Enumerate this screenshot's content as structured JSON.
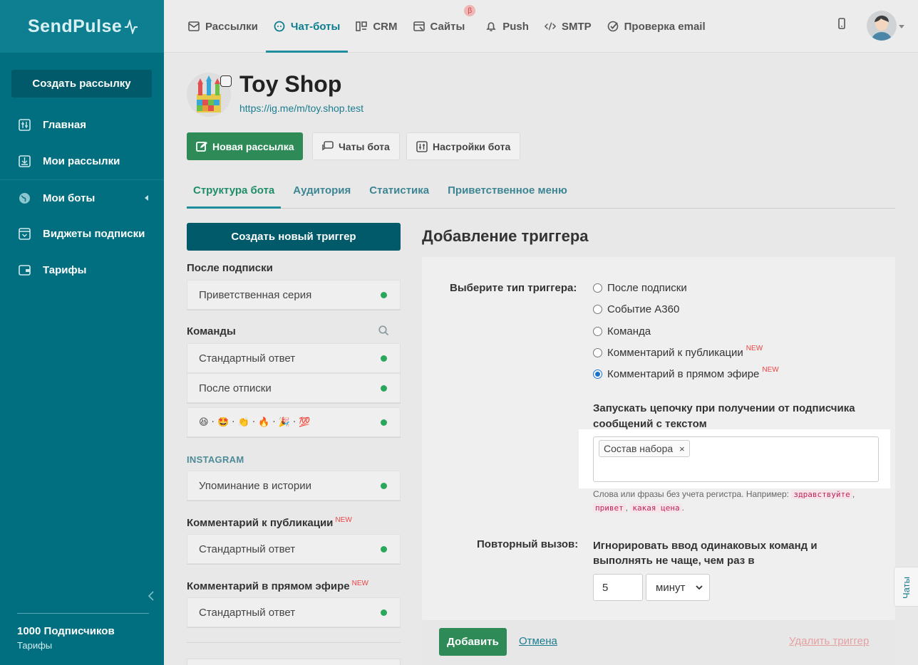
{
  "brand": {
    "logo_text": "SendPulse"
  },
  "sidebar": {
    "create_button": "Создать рассылку",
    "items": [
      {
        "label": "Главная",
        "icon": "dashboard-icon"
      },
      {
        "label": "Мои рассылки",
        "icon": "campaigns-icon"
      },
      {
        "label": "Мои боты",
        "icon": "globe-icon"
      },
      {
        "label": "Виджеты подписки",
        "icon": "widget-icon"
      },
      {
        "label": "Тарифы",
        "icon": "wallet-icon"
      }
    ],
    "subscribers": "1000 Подписчиков",
    "tariffs": "Тарифы"
  },
  "topnav": {
    "items": [
      {
        "label": "Рассылки",
        "icon": "mail-icon"
      },
      {
        "label": "Чат-боты",
        "icon": "chatbot-icon"
      },
      {
        "label": "CRM",
        "icon": "crm-icon"
      },
      {
        "label": "Сайты",
        "icon": "site-icon"
      },
      {
        "label": "Push",
        "icon": "bell-icon"
      },
      {
        "label": "SMTP",
        "icon": "code-icon"
      },
      {
        "label": "Проверка email",
        "icon": "check-icon"
      }
    ],
    "beta_badge": "β"
  },
  "bot": {
    "name": "Toy Shop",
    "url": "https://ig.me/m/toy.shop.test"
  },
  "actions": {
    "new_campaign": "Новая рассылка",
    "bot_chats": "Чаты бота",
    "bot_settings": "Настройки бота"
  },
  "tabs": [
    "Структура бота",
    "Аудитория",
    "Статистика",
    "Приветственное меню"
  ],
  "left": {
    "create_trigger": "Создать новый триггер",
    "after_subscribe_title": "После подписки",
    "welcome_series": "Приветственная серия",
    "commands_title": "Команды",
    "standard_answer": "Стандартный ответ",
    "after_unsubscribe": "После отписки",
    "emoji_row": "😆 · 🤩 · 👏 · 🔥 · 🎉 · 💯",
    "instagram_label": "INSTAGRAM",
    "story_mention": "Упоминание в истории",
    "post_comment_title": "Комментарий к публикации",
    "post_comment_item": "Стандартный ответ",
    "live_comment_title": "Комментарий в прямом эфире",
    "live_comment_item": "Стандартный ответ",
    "new_tag": "NEW"
  },
  "form": {
    "title": "Добавление триггера",
    "type_label": "Выберите тип триггера:",
    "options": [
      {
        "label": "После подписки",
        "checked": false,
        "new": false
      },
      {
        "label": "Событие А360",
        "checked": false,
        "new": false
      },
      {
        "label": "Команда",
        "checked": false,
        "new": false
      },
      {
        "label": "Комментарий к публикации",
        "checked": false,
        "new": true
      },
      {
        "label": "Комментарий в прямом эфире",
        "checked": true,
        "new": true
      }
    ],
    "chain_label": "Запускать цепочку при получении от подписчика сообщений с текстом",
    "tag_value": "Состав набора",
    "hint_prefix": "Слова или фразы без учета регистра. Например:",
    "hint_examples": [
      "здравствуйте",
      "привет",
      "какая цена"
    ],
    "repeat_label": "Повторный вызов:",
    "repeat_text": "Игнорировать ввод одинаковых команд и выполнять не чаще, чем раз в",
    "repeat_value": "5",
    "repeat_unit": "минут",
    "add_button": "Добавить",
    "cancel": "Отмена",
    "delete": "Удалить триггер"
  },
  "chats_tab": "Чаты",
  "colors": {
    "sidebar": "#016f80",
    "primary_dark": "#005a6a",
    "green": "#2e8b57",
    "link": "#1a7d8f",
    "new_tag": "#e44444"
  }
}
